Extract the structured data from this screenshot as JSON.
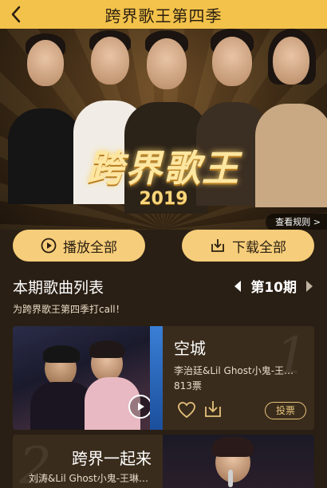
{
  "header": {
    "title": "跨界歌王第四季",
    "back_icon": "chevron-left-icon"
  },
  "hero": {
    "logo_text": "跨界歌王",
    "year": "2019",
    "rules_label": "查看规则 >"
  },
  "actions": {
    "play_all": "播放全部",
    "download_all": "下载全部"
  },
  "section": {
    "title": "本期歌曲列表",
    "issue_label": "第10期",
    "slogan": "为跨界歌王第四季打call！"
  },
  "songs": [
    {
      "rank": "1",
      "name": "空城",
      "singer": "李治廷&Lil Ghost小鬼-王…",
      "votes": "813票",
      "vote_label": "投票"
    },
    {
      "rank": "2",
      "name": "跨界一起来",
      "singer": "刘涛&Lil Ghost小鬼-王琳…"
    }
  ],
  "colors": {
    "topbar": "#f2c24a",
    "button": "#f6cd7a",
    "background": "#2a1f14",
    "vote_accent": "#e6c27c"
  }
}
